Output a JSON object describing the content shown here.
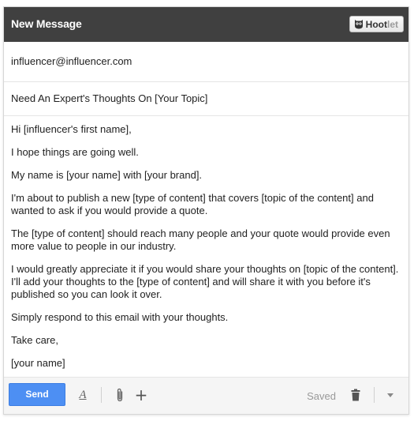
{
  "window": {
    "title": "New Message",
    "extension_button": {
      "label_main": "Hoot",
      "label_light": "let"
    }
  },
  "to": {
    "value": "influencer@influencer.com"
  },
  "subject": {
    "value": "Need An Expert's Thoughts On [Your Topic]"
  },
  "body": {
    "paragraphs": [
      "Hi [influencer's first name],",
      "I hope things are going well.",
      "My name is [your name] with [your brand].",
      "I'm about to publish a new [type of content] that covers [topic of the content] and wanted to ask if you would provide a quote.",
      "The [type of content] should reach many people and your quote would provide even more value to people in our industry.",
      "I would greatly appreciate it if you would share your thoughts on [topic of the content]. I'll add your thoughts to the [type of content] and will share it with you before it's published so you can look it over.",
      "Simply respond to this email with your thoughts.",
      "Take care,",
      "[your name]"
    ]
  },
  "toolbar": {
    "send_label": "Send",
    "format_glyph": "A",
    "plus_glyph": "+",
    "saved_label": "Saved"
  },
  "icons": {
    "hootlet": "owl-icon",
    "format": "text-format-icon",
    "attach": "paperclip-icon",
    "insert": "plus-icon",
    "discard": "trash-icon",
    "more": "chevron-down-icon"
  },
  "colors": {
    "titlebar": "#404040",
    "send_button": "#4d8ff3"
  }
}
